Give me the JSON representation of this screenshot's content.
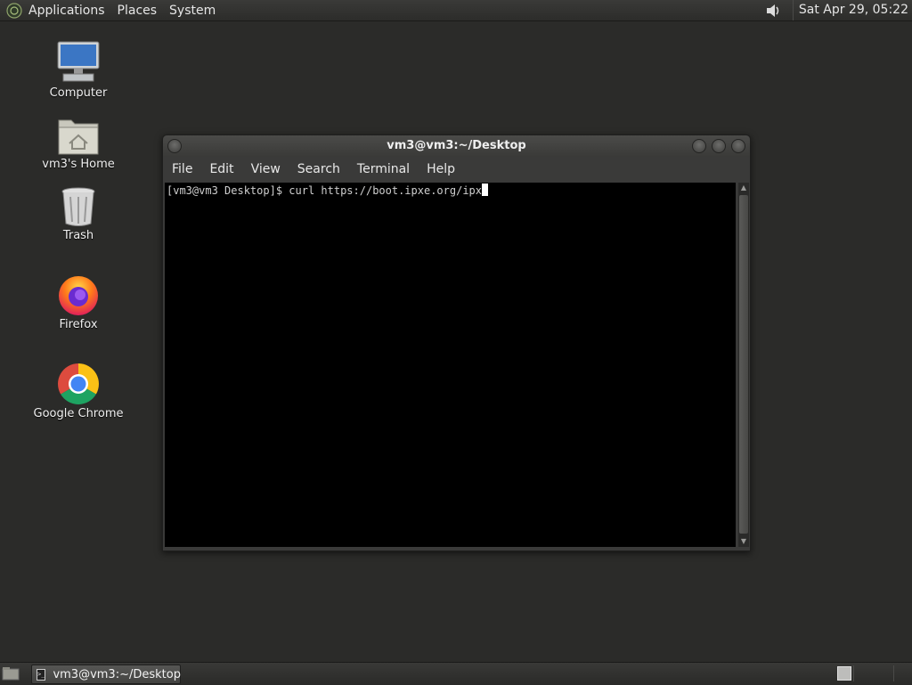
{
  "top_panel": {
    "menus": [
      "Applications",
      "Places",
      "System"
    ],
    "clock": "Sat Apr 29, 05:22"
  },
  "desktop_icons": [
    {
      "label": "Computer",
      "icon": "computer-icon"
    },
    {
      "label": "vm3's Home",
      "icon": "home-folder-icon"
    },
    {
      "label": "Trash",
      "icon": "trash-icon"
    },
    {
      "label": "Firefox",
      "icon": "firefox-icon"
    },
    {
      "label": "Google Chrome",
      "icon": "chrome-icon"
    }
  ],
  "terminal": {
    "title": "vm3@vm3:~/Desktop",
    "menu": [
      "File",
      "Edit",
      "View",
      "Search",
      "Terminal",
      "Help"
    ],
    "line": "[vm3@vm3 Desktop]$ curl https://boot.ipxe.org/ipx"
  },
  "taskbar": {
    "window_label": "vm3@vm3:~/Desktop"
  }
}
